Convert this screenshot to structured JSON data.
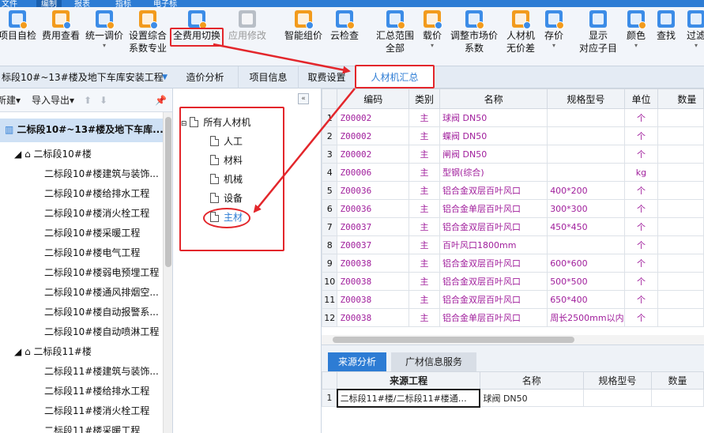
{
  "menu": {
    "items": [
      "文件",
      "编制",
      "报表",
      "指标",
      "电子标"
    ]
  },
  "ribbon": {
    "items": [
      {
        "label": "项目自检",
        "sub": ""
      },
      {
        "label": "费用查看",
        "sub": ""
      },
      {
        "label": "统一调价",
        "sub": "▾"
      },
      {
        "label": "设置综合",
        "sub": "系数专业"
      },
      {
        "label": "全费用切换",
        "sub": ""
      },
      {
        "label": "应用修改",
        "sub": ""
      },
      {
        "label": "智能组价",
        "sub": ""
      },
      {
        "label": "云检查",
        "sub": ""
      },
      {
        "label": "汇总范围",
        "sub": "全部"
      },
      {
        "label": "载价",
        "sub": "▾"
      },
      {
        "label": "调整市场价",
        "sub": "系数"
      },
      {
        "label": "人材机",
        "sub": "无价差"
      },
      {
        "label": "存价",
        "sub": "▾"
      },
      {
        "label": "显示",
        "sub": "对应子目"
      },
      {
        "label": "颜色",
        "sub": "▾"
      },
      {
        "label": "查找",
        "sub": ""
      },
      {
        "label": "过滤",
        "sub": "▾"
      }
    ]
  },
  "project": {
    "title": "标段10#~13#楼及地下车库安装工程"
  },
  "tabs": [
    "造价分析",
    "项目信息",
    "取费设置",
    "人材机汇总"
  ],
  "left_toolbar": {
    "new": "新建▾",
    "import_export": "导入导出▾"
  },
  "left_tree": {
    "root": "二标段10#~13#楼及地下车库...",
    "groups": [
      {
        "name": "二标段10#楼",
        "children": [
          "二标段10#楼建筑与装饰...",
          "二标段10#楼给排水工程",
          "二标段10#楼消火栓工程",
          "二标段10#楼采暖工程",
          "二标段10#楼电气工程",
          "二标段10#楼弱电预埋工程",
          "二标段10#楼通风排烟空...",
          "二标段10#楼自动报警系...",
          "二标段10#楼自动喷淋工程"
        ]
      },
      {
        "name": "二标段11#楼",
        "children": [
          "二标段11#楼建筑与装饰...",
          "二标段11#楼给排水工程",
          "二标段11#楼消火栓工程",
          "二标段11#楼采暖工程"
        ]
      }
    ]
  },
  "material_tree": {
    "root": "所有人材机",
    "children": [
      "人工",
      "材料",
      "机械",
      "设备",
      "主材"
    ]
  },
  "grid": {
    "headers": [
      "编码",
      "类别",
      "名称",
      "规格型号",
      "单位",
      "数量"
    ],
    "rows": [
      {
        "no": "1",
        "code": "Z00002",
        "type": "主",
        "name": "球阀 DN50",
        "spec": "",
        "unit": "个"
      },
      {
        "no": "2",
        "code": "Z00002",
        "type": "主",
        "name": "蝶阀 DN50",
        "spec": "",
        "unit": "个"
      },
      {
        "no": "3",
        "code": "Z00002",
        "type": "主",
        "name": "闸阀 DN50",
        "spec": "",
        "unit": "个"
      },
      {
        "no": "4",
        "code": "Z00006",
        "type": "主",
        "name": "型钢(综合)",
        "spec": "",
        "unit": "kg"
      },
      {
        "no": "5",
        "code": "Z00036",
        "type": "主",
        "name": "铝合金双层百叶风口",
        "spec": "400*200",
        "unit": "个"
      },
      {
        "no": "6",
        "code": "Z00036",
        "type": "主",
        "name": "铝合金单层百叶风口",
        "spec": "300*300",
        "unit": "个"
      },
      {
        "no": "7",
        "code": "Z00037",
        "type": "主",
        "name": "铝合金双层百叶风口",
        "spec": "450*450",
        "unit": "个"
      },
      {
        "no": "8",
        "code": "Z00037",
        "type": "主",
        "name": "百叶风口1800mm",
        "spec": "",
        "unit": "个"
      },
      {
        "no": "9",
        "code": "Z00038",
        "type": "主",
        "name": "铝合金双层百叶风口",
        "spec": "600*600",
        "unit": "个"
      },
      {
        "no": "10",
        "code": "Z00038",
        "type": "主",
        "name": "铝合金双层百叶风口",
        "spec": "500*500",
        "unit": "个"
      },
      {
        "no": "11",
        "code": "Z00038",
        "type": "主",
        "name": "铝合金双层百叶风口",
        "spec": "650*400",
        "unit": "个"
      },
      {
        "no": "12",
        "code": "Z00038",
        "type": "主",
        "name": "铝合金单层百叶风口",
        "spec": "周长2500mm以内",
        "unit": "个"
      }
    ]
  },
  "bottom_tabs": [
    "来源分析",
    "广材信息服务"
  ],
  "bottom_grid": {
    "headers": [
      "来源工程",
      "名称",
      "规格型号",
      "数量"
    ],
    "rows": [
      {
        "no": "1",
        "source": "二标段11#楼/二标段11#楼通…",
        "name": "球阀 DN50",
        "spec": "",
        "qty": ""
      }
    ]
  },
  "colors": {
    "accent": "#2d7cd4",
    "highlight": "#e3262b",
    "material": "#a01e9c"
  }
}
